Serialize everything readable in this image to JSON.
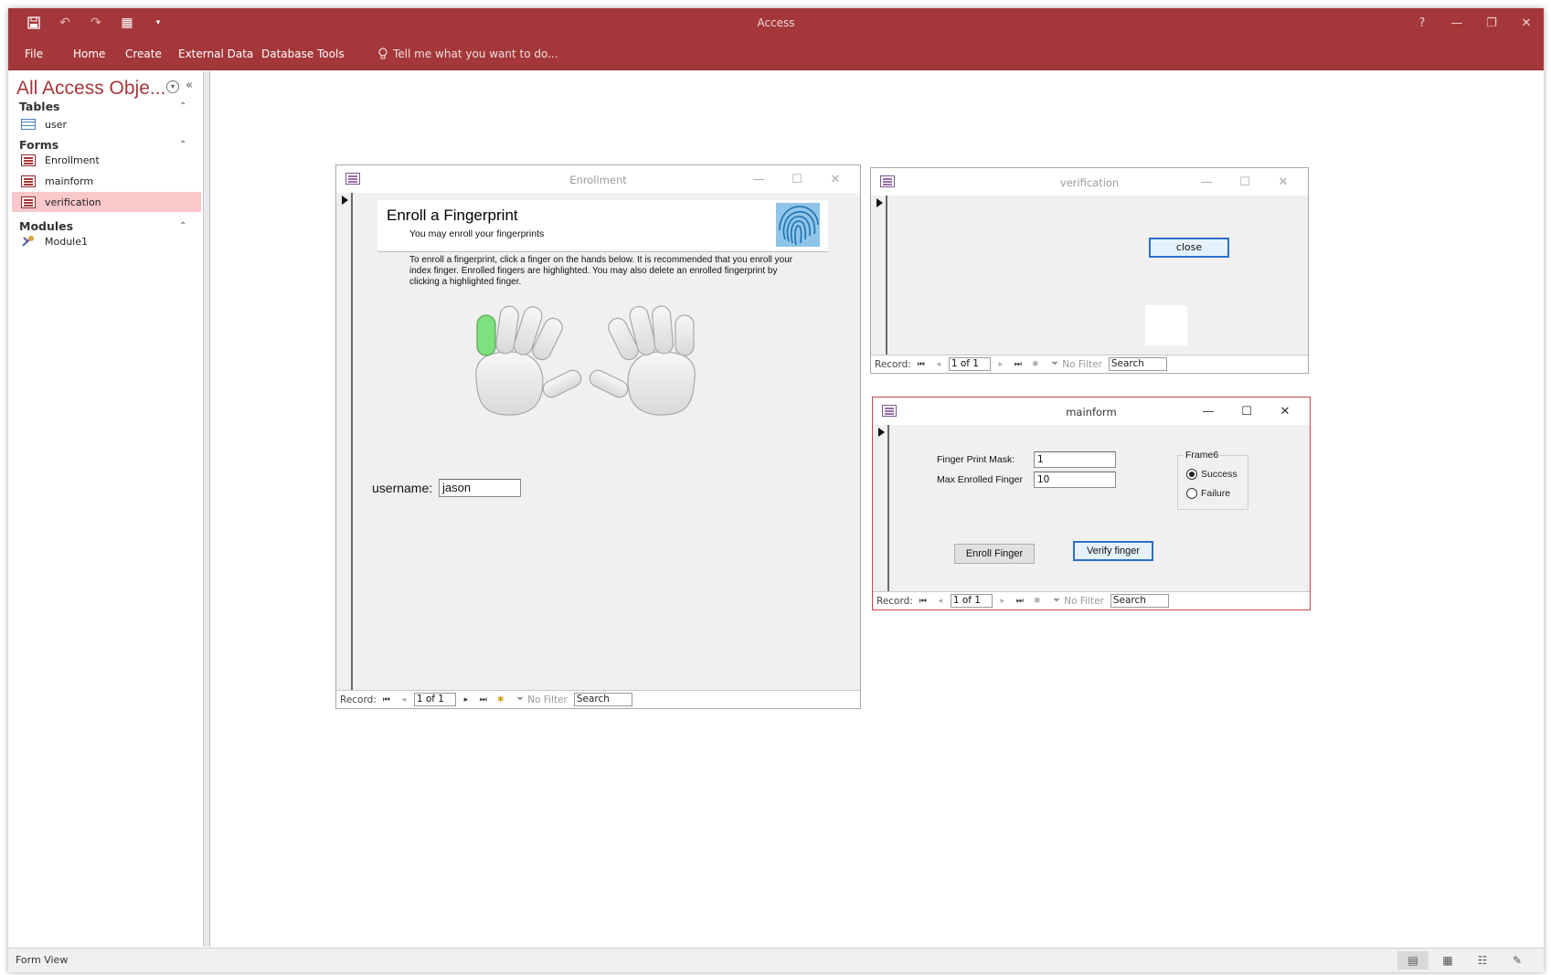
{
  "app": {
    "title": "Access"
  },
  "ribbon": {
    "tabs": [
      "File",
      "Home",
      "Create",
      "External Data",
      "Database Tools"
    ],
    "tell_me": "Tell me what you want to do..."
  },
  "nav": {
    "title": "All Access Obje...",
    "groups": {
      "tables": {
        "label": "Tables",
        "items": [
          "user"
        ]
      },
      "forms": {
        "label": "Forms",
        "items": [
          "Enrollment",
          "mainform",
          "verification"
        ]
      },
      "modules": {
        "label": "Modules",
        "items": [
          "Module1"
        ]
      }
    },
    "selected": "verification"
  },
  "enrollment": {
    "title": "Enrollment",
    "heading": "Enroll a Fingerprint",
    "subheading": "You may enroll your fingerprints",
    "instructions": "To enroll a fingerprint, click a finger on the hands below. It is recommended that you enroll your index finger. Enrolled fingers are highlighted. You may also delete an enrolled fingerprint by clicking a highlighted finger.",
    "username_label": "username:",
    "username_value": "jason",
    "highlight_color": "#7ee07e"
  },
  "verification": {
    "title": "verification",
    "close_label": "close"
  },
  "mainform": {
    "title": "mainform",
    "mask_label": "Finger Print Mask:",
    "mask_value": "1",
    "max_label": "Max Enrolled Finger",
    "max_value": "10",
    "frame_label": "Frame6",
    "option_success": "Success",
    "option_failure": "Failure",
    "enroll_button": "Enroll Finger",
    "verify_button": "Verify finger"
  },
  "record_nav": {
    "label": "Record:",
    "position": "1 of 1",
    "filter": "No Filter",
    "search": "Search"
  },
  "statusbar": {
    "text": "Form View"
  },
  "colors": {
    "brand": "#a4373a",
    "selected_nav": "#f9c8cb"
  }
}
